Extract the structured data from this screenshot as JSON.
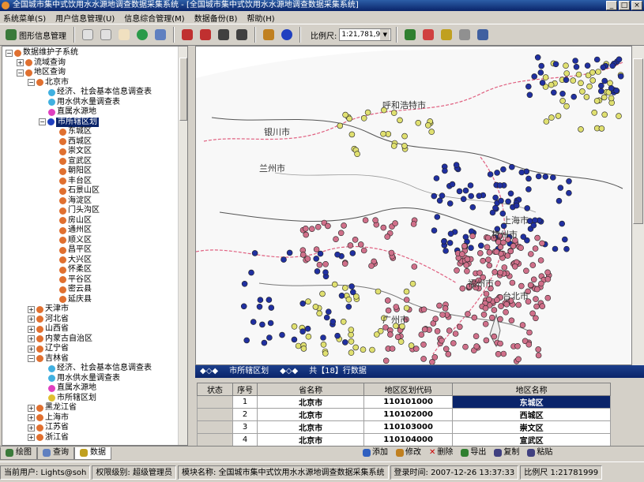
{
  "window": {
    "title": "全国城市集中式饮用水水源地调查数据采集系统 - [全国城市集中式饮用水水源地调查数据采集系统]"
  },
  "menu": [
    "系统菜单(S)",
    "用户信息管理(U)",
    "信息综合管理(M)",
    "数据备份(B)",
    "帮助(H)"
  ],
  "toolbar": {
    "gis_label": "图形信息管理",
    "scale_label": "比例尺:",
    "scale_value": "1:21,781,999"
  },
  "tree": {
    "root": "数据维护子系统",
    "basin": "流域查询",
    "region": "地区查询",
    "beijing": "北京市",
    "econ": "经济、社会基本信息调查表",
    "water_use": "用水供水量调查表",
    "supply": "直属水源地",
    "districts_node": "市所辖区划",
    "districts": [
      "东城区",
      "西城区",
      "崇文区",
      "宣武区",
      "朝阳区",
      "丰台区",
      "石景山区",
      "海淀区",
      "门头沟区",
      "房山区",
      "通州区",
      "顺义区",
      "昌平区",
      "大兴区",
      "怀柔区",
      "平谷区",
      "密云县",
      "延庆县"
    ],
    "provinces_a": [
      "天津市",
      "河北省",
      "山西省",
      "内蒙古自治区",
      "辽宁省"
    ],
    "jilin": "吉林省",
    "jilin_children": [
      "经济、社会基本信息调查表",
      "用水供水量调查表",
      "直属水源地",
      "市所辖区划"
    ],
    "provinces_b": [
      "黑龙江省",
      "上海市",
      "江苏省",
      "浙江省"
    ]
  },
  "map": {
    "labels": [
      "呼和浩特市",
      "银川市",
      "兰州市",
      "上海市",
      "杭州市",
      "福州市",
      "台北市",
      "广州市"
    ]
  },
  "grid": {
    "title": "市所辖区划",
    "count": "共【18】行数据",
    "headers": [
      "状态",
      "序号",
      "省名称",
      "地区区划代码",
      "地区名称"
    ],
    "rows": [
      [
        "",
        "1",
        "北京市",
        "110101000",
        "东城区"
      ],
      [
        "",
        "2",
        "北京市",
        "110102000",
        "西城区"
      ],
      [
        "",
        "3",
        "北京市",
        "110103000",
        "崇文区"
      ],
      [
        "",
        "4",
        "北京市",
        "110104000",
        "宣武区"
      ]
    ]
  },
  "tabs": [
    "绘图",
    "查询",
    "数据"
  ],
  "actions": [
    "添加",
    "修改",
    "删除",
    "导出",
    "复制",
    "粘贴"
  ],
  "status": {
    "user": "当前用户: Lights@soh",
    "level": "权限级别: 超级管理员",
    "module": "模块名称: 全国城市集中式饮用水水源地调查数据采集系统",
    "login": "登录时间: 2007-12-26 13:37:33",
    "scale": "比例尺 1:21781999"
  }
}
